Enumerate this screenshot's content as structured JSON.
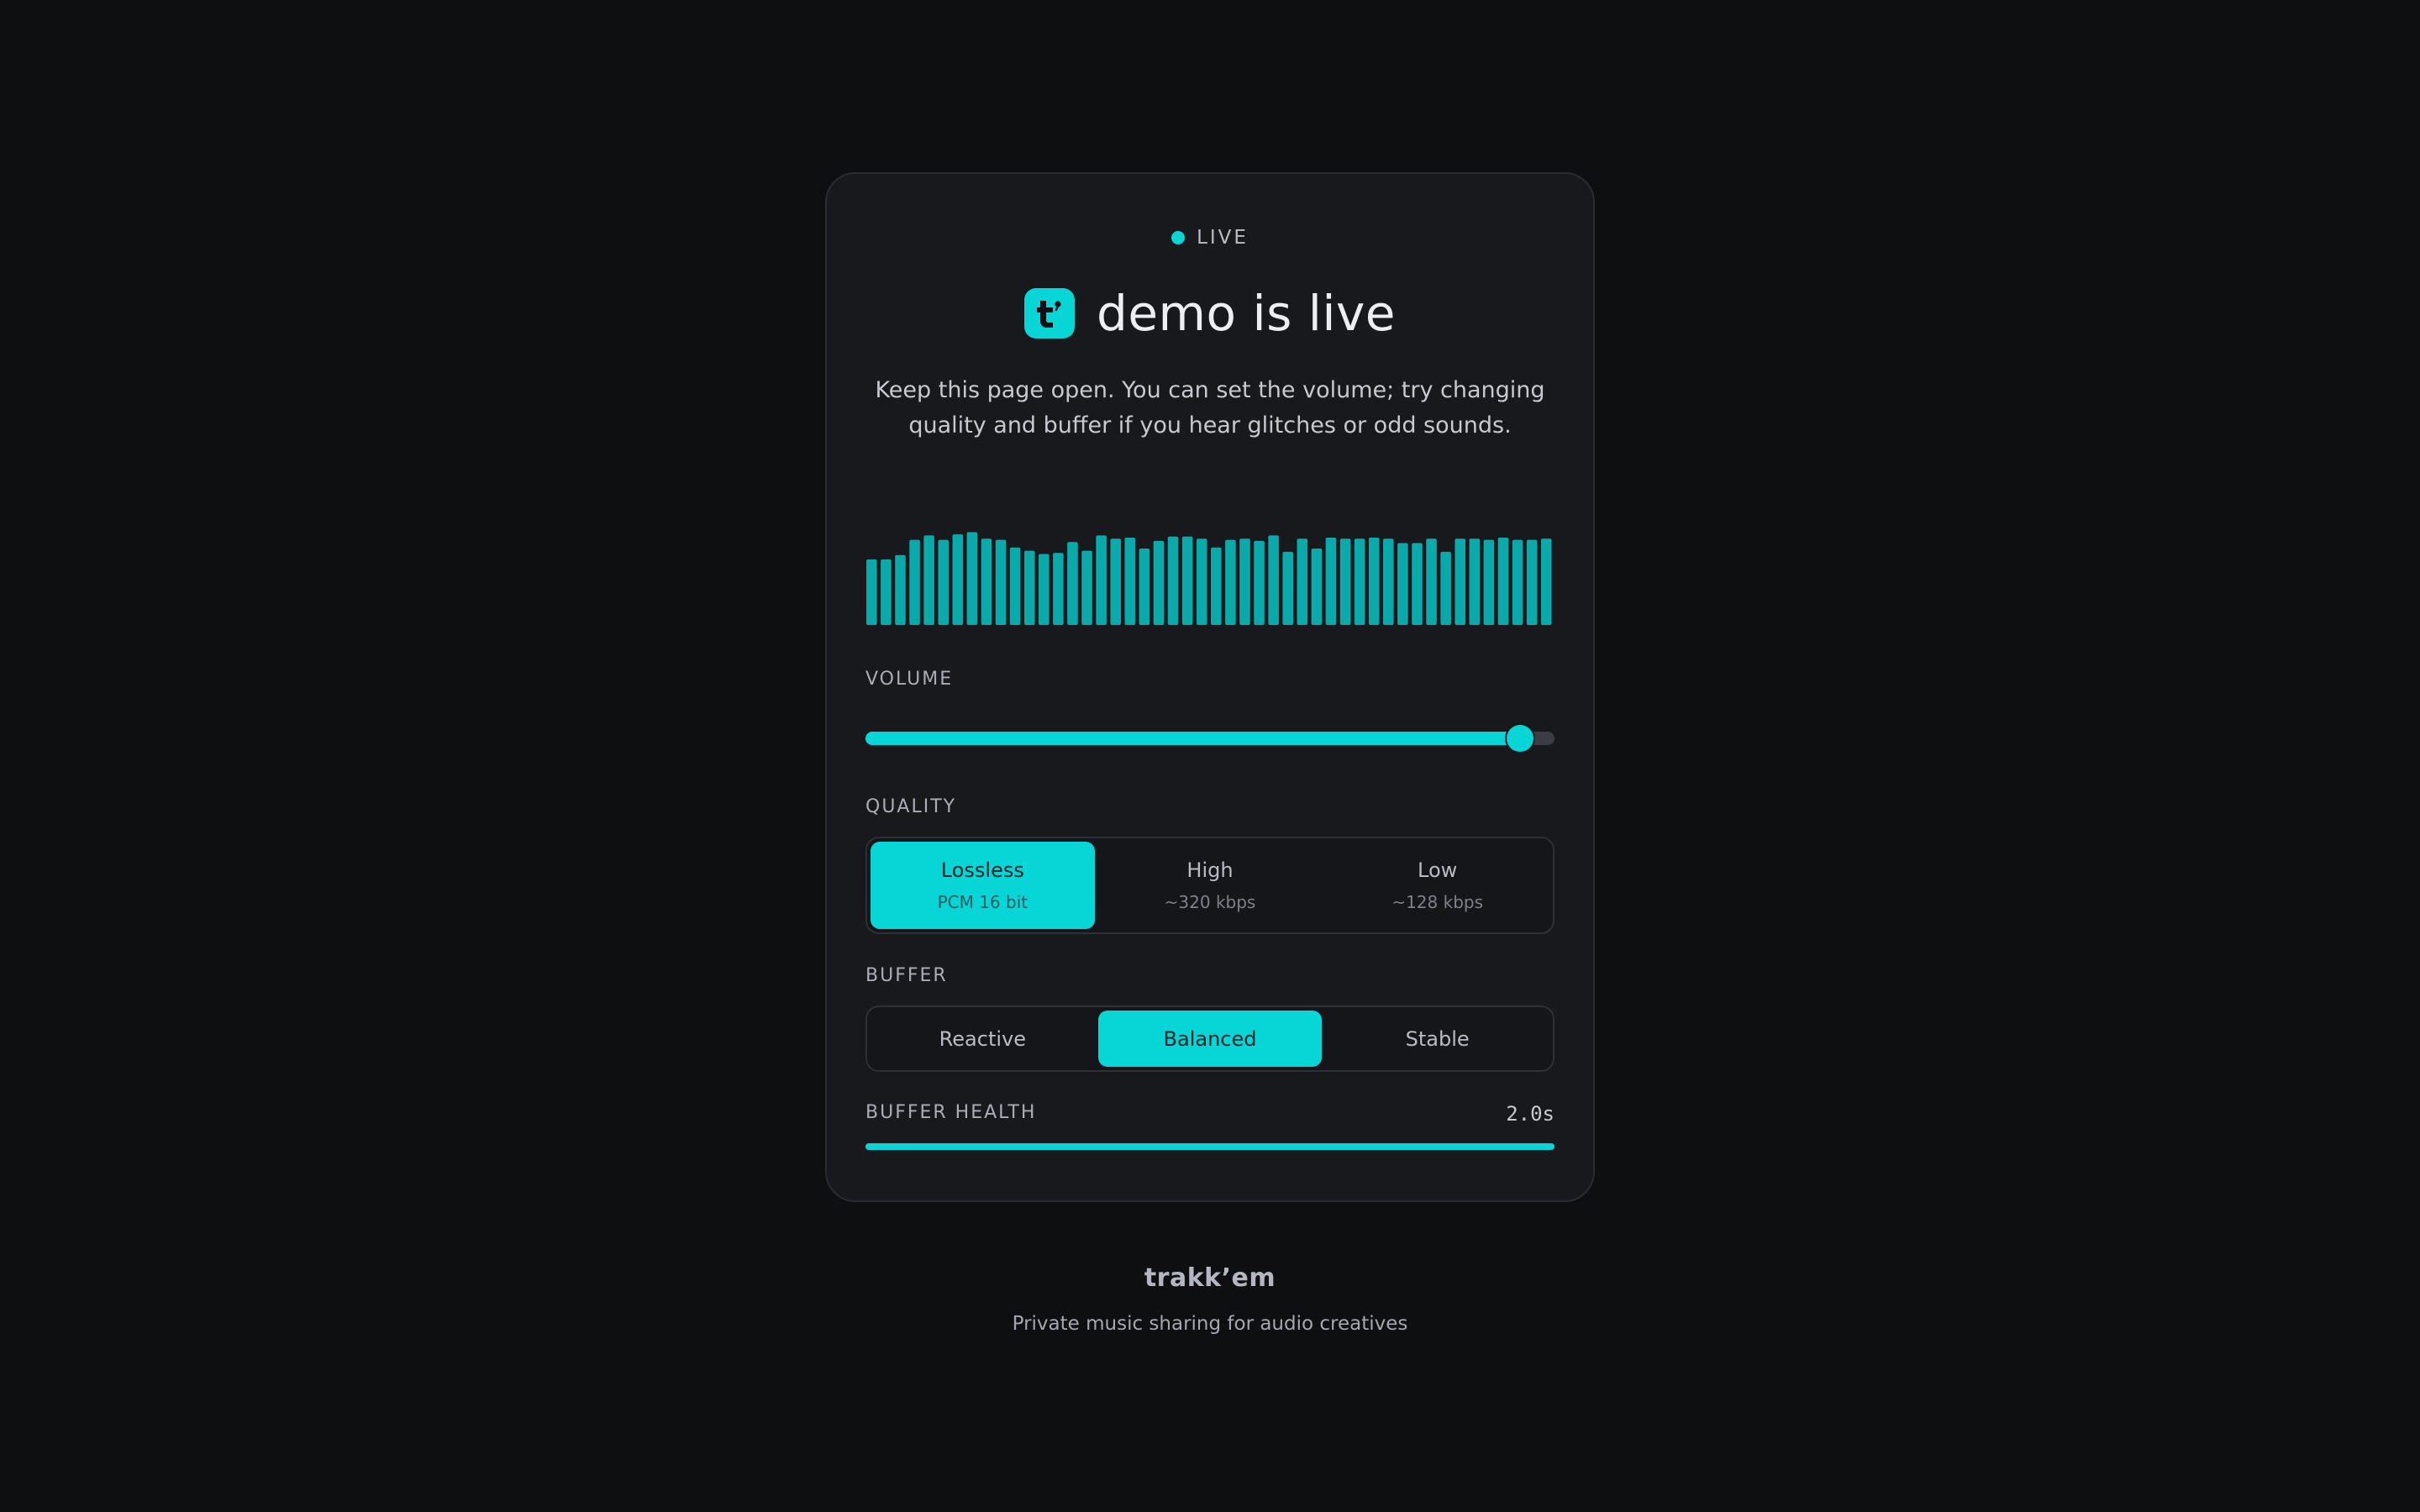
{
  "status": {
    "label": "LIVE",
    "dot_color": "#07d5d6"
  },
  "header": {
    "logo_icon": "trakkem-logo-icon",
    "title": "demo is live"
  },
  "description": "Keep this page open. You can set the volume; try changing quality and buffer if you hear glitches or odd sounds.",
  "visualizer": {
    "color": "#0aa9aa",
    "levels": [
      0.6,
      0.6,
      0.64,
      0.78,
      0.82,
      0.78,
      0.83,
      0.85,
      0.79,
      0.78,
      0.71,
      0.68,
      0.65,
      0.66,
      0.76,
      0.68,
      0.82,
      0.79,
      0.8,
      0.7,
      0.77,
      0.81,
      0.81,
      0.79,
      0.71,
      0.78,
      0.79,
      0.77,
      0.82,
      0.67,
      0.79,
      0.7,
      0.8,
      0.79,
      0.79,
      0.8,
      0.79,
      0.75,
      0.75,
      0.79,
      0.67,
      0.79,
      0.79,
      0.78,
      0.8,
      0.78,
      0.78,
      0.79
    ]
  },
  "volume": {
    "label": "VOLUME",
    "value": 0.95
  },
  "quality": {
    "label": "QUALITY",
    "options": [
      {
        "label": "Lossless",
        "sub": "PCM 16 bit",
        "active": true
      },
      {
        "label": "High",
        "sub": "~320 kbps",
        "active": false
      },
      {
        "label": "Low",
        "sub": "~128 kbps",
        "active": false
      }
    ]
  },
  "buffer": {
    "label": "BUFFER",
    "options": [
      {
        "label": "Reactive",
        "active": false
      },
      {
        "label": "Balanced",
        "active": true
      },
      {
        "label": "Stable",
        "active": false
      }
    ]
  },
  "buffer_health": {
    "label": "BUFFER HEALTH",
    "value_text": "2.0s",
    "fill": 1.0
  },
  "footer": {
    "brand": "trakk’em",
    "tagline": "Private music sharing for audio creatives"
  },
  "colors": {
    "accent": "#07d5d6",
    "background": "#0e0f11",
    "card": "#18191d"
  }
}
